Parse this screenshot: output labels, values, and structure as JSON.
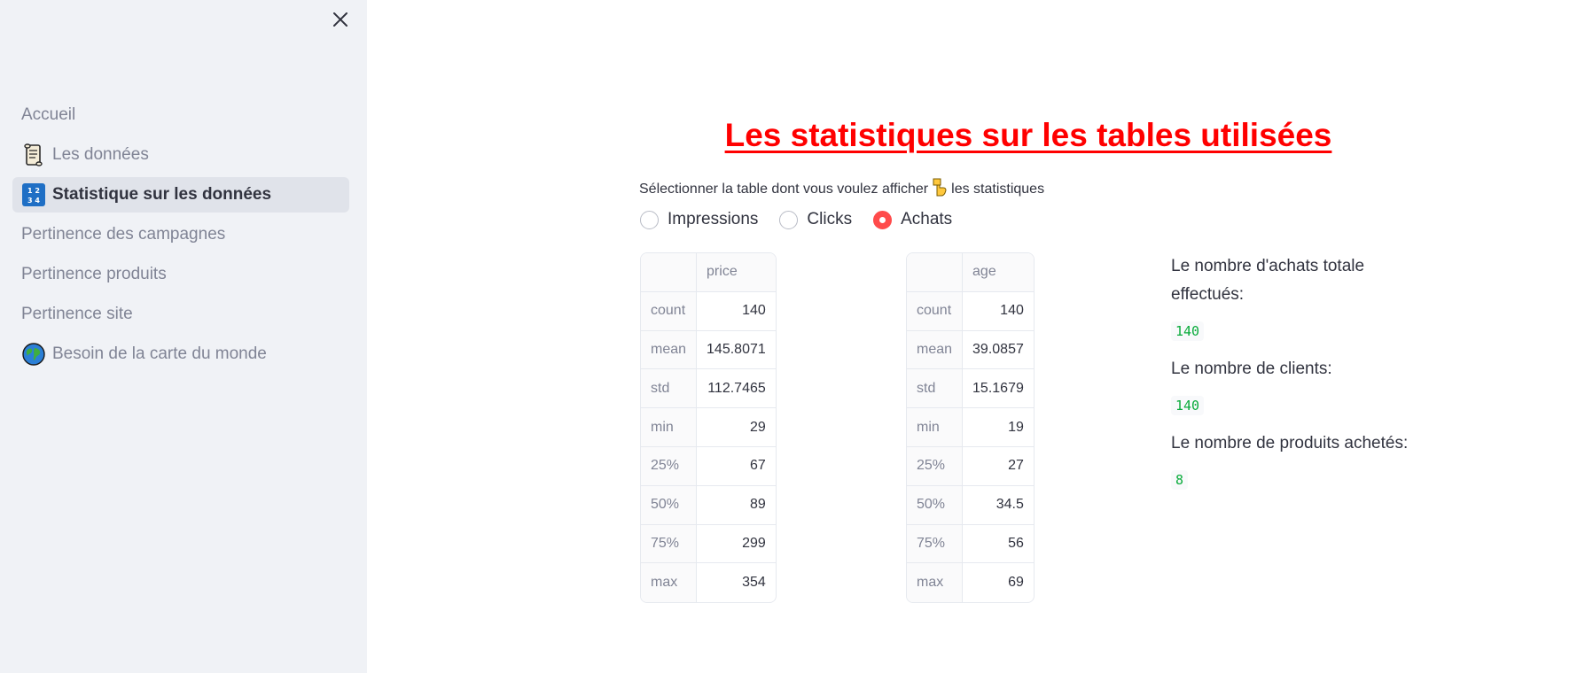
{
  "sidebar": {
    "items": [
      {
        "label": "Accueil",
        "icon": "",
        "active": false
      },
      {
        "label": "Les données",
        "icon": "scroll-icon",
        "active": false
      },
      {
        "label": "Statistique sur les données",
        "icon": "numbers-icon",
        "active": true
      },
      {
        "label": "Pertinence des campagnes",
        "icon": "",
        "active": false
      },
      {
        "label": "Pertinence produits",
        "icon": "",
        "active": false
      },
      {
        "label": "Pertinence site",
        "icon": "",
        "active": false
      },
      {
        "label": "Besoin de la carte du monde",
        "icon": "globe-icon",
        "active": false
      }
    ]
  },
  "main": {
    "title": "Les statistiques sur les tables utilisées",
    "subtitle_before": "Sélectionner la table dont vous voulez afficher",
    "subtitle_after": "les statistiques",
    "radio": {
      "options": [
        "Impressions",
        "Clicks",
        "Achats"
      ],
      "selected": "Achats"
    },
    "tables": [
      {
        "column": "price",
        "rows": [
          {
            "stat": "count",
            "value": "140"
          },
          {
            "stat": "mean",
            "value": "145.8071"
          },
          {
            "stat": "std",
            "value": "112.7465"
          },
          {
            "stat": "min",
            "value": "29"
          },
          {
            "stat": "25%",
            "value": "67"
          },
          {
            "stat": "50%",
            "value": "89"
          },
          {
            "stat": "75%",
            "value": "299"
          },
          {
            "stat": "max",
            "value": "354"
          }
        ]
      },
      {
        "column": "age",
        "rows": [
          {
            "stat": "count",
            "value": "140"
          },
          {
            "stat": "mean",
            "value": "39.0857"
          },
          {
            "stat": "std",
            "value": "15.1679"
          },
          {
            "stat": "min",
            "value": "19"
          },
          {
            "stat": "25%",
            "value": "27"
          },
          {
            "stat": "50%",
            "value": "34.5"
          },
          {
            "stat": "75%",
            "value": "56"
          },
          {
            "stat": "max",
            "value": "69"
          }
        ]
      }
    ],
    "info": [
      {
        "label": "Le nombre d'achats totale effectués:",
        "value": "140"
      },
      {
        "label": "Le nombre de clients:",
        "value": "140"
      },
      {
        "label": "Le nombre de produits achetés:",
        "value": "8"
      }
    ]
  },
  "colors": {
    "title": "#ff0000",
    "radio_accent": "#ff4b4b",
    "code_text": "#09ab3b",
    "sidebar_bg": "#f0f2f6"
  }
}
